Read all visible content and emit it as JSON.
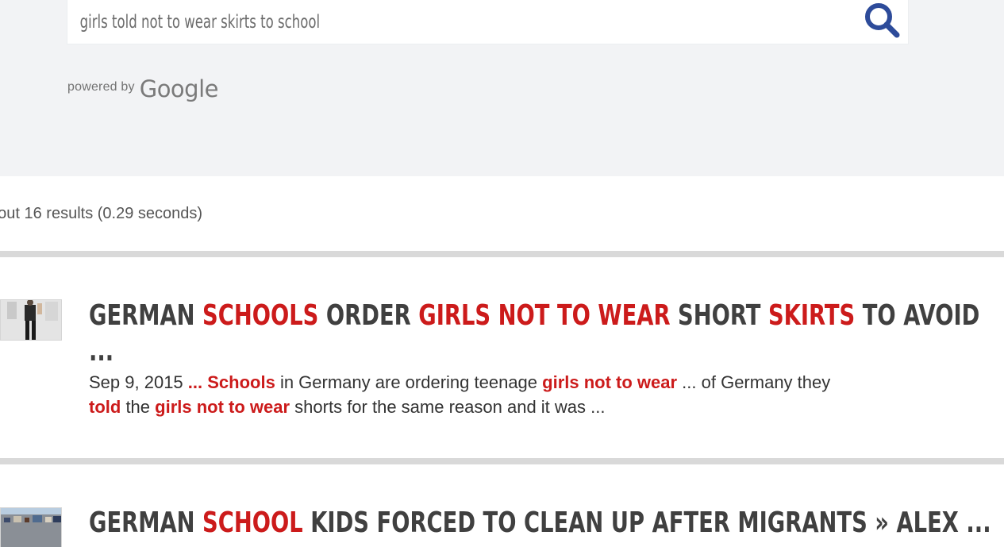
{
  "search": {
    "query": "girls told not to wear skirts to school",
    "powered_by_label": "powered by",
    "google_label": "Google"
  },
  "results_info": "bout 16 results (0.29 seconds)",
  "results": [
    {
      "title_parts": [
        "German ",
        "Schools",
        " Order ",
        "Girls Not To Wear",
        " Short ",
        "Skirts",
        " To Avoid"
      ],
      "title_line2": "...",
      "date": "Sep 9, 2015",
      "snippet_parts": [
        " ",
        "... Schools",
        " in Germany are ordering teenage ",
        "girls not to wear",
        " ... of Germany they "
      ],
      "snippet_line2_parts": [
        "told",
        " the ",
        "girls not to wear",
        " shorts for the same reason and it was ..."
      ]
    },
    {
      "title_parts": [
        "German ",
        "School",
        " Kids Forced To Clean Up After Migrants » Alex ..."
      ]
    }
  ],
  "colors": {
    "highlight": "#cc1b1b",
    "title_text": "#404040",
    "search_icon": "#2d4b9a",
    "top_band": "#f2f3f5",
    "divider": "#d9d9d9"
  },
  "icons": {
    "search": "search-icon",
    "result_1_thumb": "result-thumbnail-image",
    "result_2_thumb": "result-thumbnail-image"
  }
}
